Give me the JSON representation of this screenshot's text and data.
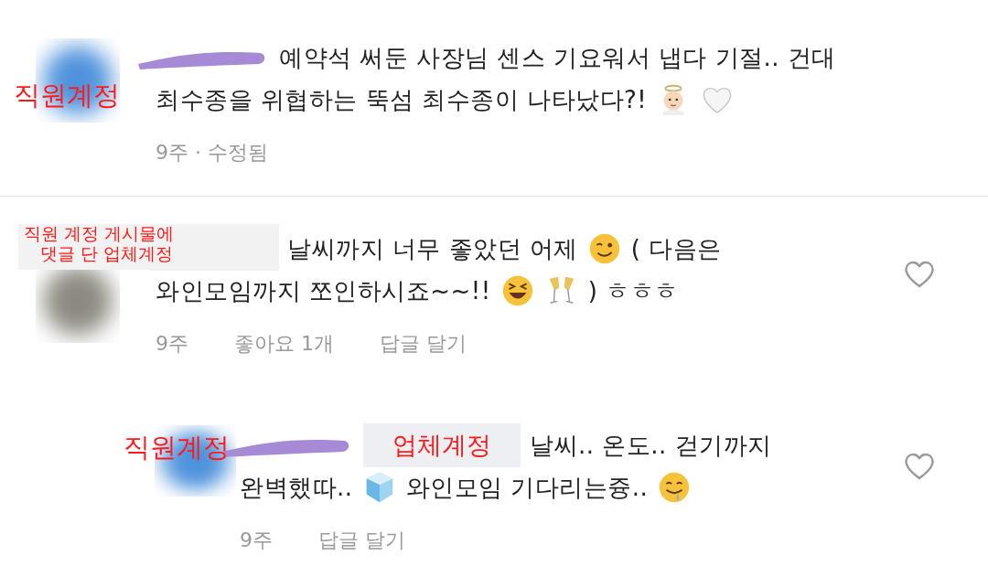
{
  "comments": [
    {
      "reply": false,
      "avatar": {
        "kind": "picture",
        "color": "#4f93dc"
      },
      "annotation": {
        "kind": "plain",
        "lines": [
          "직원계정"
        ]
      },
      "redactions": [
        {
          "kind": "scribble"
        }
      ],
      "lines": [
        [
          {
            "kind": "text",
            "text": "예약석 써둔 사장님 센스 기요워서 냅다 기절.. 건대"
          }
        ],
        [
          {
            "kind": "text",
            "text": "최수종을 위협하는 뚝섬 최수종이 나타났다?!"
          },
          {
            "kind": "angel"
          },
          {
            "kind": "heart"
          }
        ]
      ],
      "meta": [
        "9주 · 수정됨"
      ]
    },
    {
      "reply": false,
      "avatar": {
        "kind": "picture",
        "color": "#8c8a80"
      },
      "annotation": {
        "kind": "boxed",
        "lines": [
          "직원 계정 게시물에",
          "댓글 단 업체계정"
        ]
      },
      "redactions": [
        {
          "kind": "box"
        }
      ],
      "lines": [
        [
          {
            "kind": "text",
            "text": "날씨까지 너무 좋았던 어제"
          },
          {
            "kind": "wink"
          },
          {
            "kind": "text",
            "text": "( 다음은"
          }
        ],
        [
          {
            "kind": "text",
            "text": "와인모임까지 쪼인하시죠~~!!"
          },
          {
            "kind": "laugh"
          },
          {
            "kind": "cheers"
          },
          {
            "kind": "text",
            "text": ") ㅎㅎㅎ"
          }
        ]
      ],
      "meta": [
        "9주",
        "좋아요 1개",
        "답글 달기"
      ],
      "like_button": {
        "liked": false
      }
    },
    {
      "reply": true,
      "avatar": {
        "kind": "picture",
        "color": "#4f93dc"
      },
      "annotation": {
        "kind": "plain",
        "lines": [
          "직원계정"
        ]
      },
      "redactions": [
        {
          "kind": "scribble"
        },
        {
          "kind": "box",
          "label": "업체계정"
        }
      ],
      "lines": [
        [
          {
            "kind": "text",
            "text": "날씨.. 온도.. 걷기까지"
          }
        ],
        [
          {
            "kind": "text",
            "text": "완벽했따.."
          },
          {
            "kind": "ice"
          },
          {
            "kind": "text",
            "text": "와인모임 기다리는즁.."
          },
          {
            "kind": "drool"
          }
        ]
      ],
      "meta": [
        "9주",
        "답글 달기"
      ],
      "like_button": {
        "liked": false
      }
    }
  ]
}
